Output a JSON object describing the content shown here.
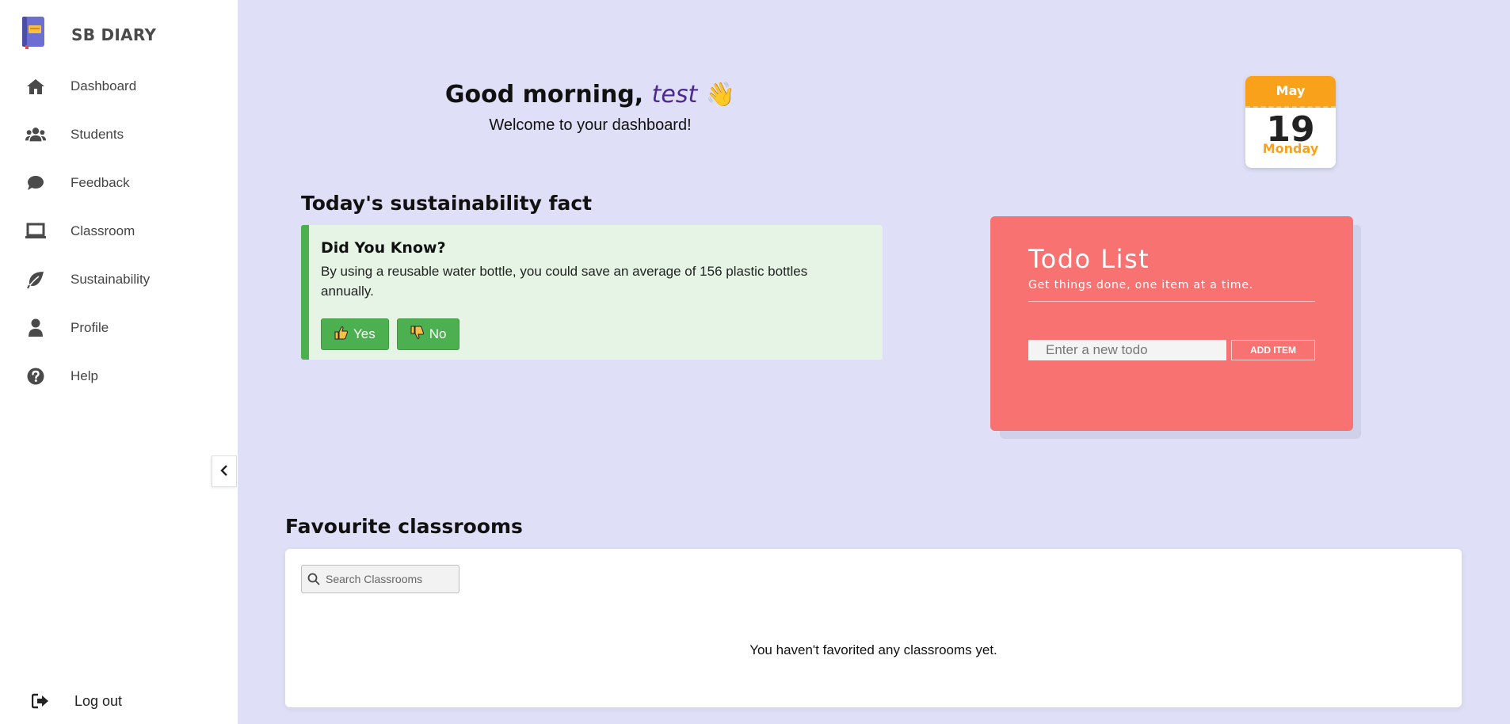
{
  "brand": {
    "name": "SB DIARY",
    "logo_icon": "diary-book-icon"
  },
  "sidebar": {
    "items": [
      {
        "label": "Dashboard",
        "icon": "home-icon"
      },
      {
        "label": "Students",
        "icon": "users-icon"
      },
      {
        "label": "Feedback",
        "icon": "comment-icon"
      },
      {
        "label": "Classroom",
        "icon": "laptop-icon"
      },
      {
        "label": "Sustainability",
        "icon": "leaf-icon"
      },
      {
        "label": "Profile",
        "icon": "user-icon"
      },
      {
        "label": "Help",
        "icon": "help-icon"
      }
    ],
    "logout_label": "Log out",
    "collapse_icon": "chevron-left-icon"
  },
  "greeting": {
    "prefix": "Good morning, ",
    "name": "test",
    "emoji": "👋",
    "subtitle": "Welcome to your dashboard!"
  },
  "calendar": {
    "month": "May",
    "day": "19",
    "weekday": "Monday"
  },
  "sustainability": {
    "heading": "Today's sustainability fact",
    "card_title": "Did You Know?",
    "fact": "By using a reusable water bottle, you could save an average of 156 plastic bottles annually.",
    "yes_label": "Yes",
    "no_label": "No"
  },
  "todo": {
    "title": "Todo List",
    "subtitle": "Get things done, one item at a time.",
    "input_placeholder": "Enter a new todo",
    "add_label": "ADD ITEM"
  },
  "favourites": {
    "heading": "Favourite classrooms",
    "search_placeholder": "Search Classrooms",
    "empty_message": "You haven't favorited any classrooms yet."
  },
  "colors": {
    "background": "#dfe0f7",
    "todo_card": "#f87272",
    "fact_accent": "#4caf50",
    "calendar_accent": "#f9a11b",
    "name_color": "#4b2a8c"
  }
}
